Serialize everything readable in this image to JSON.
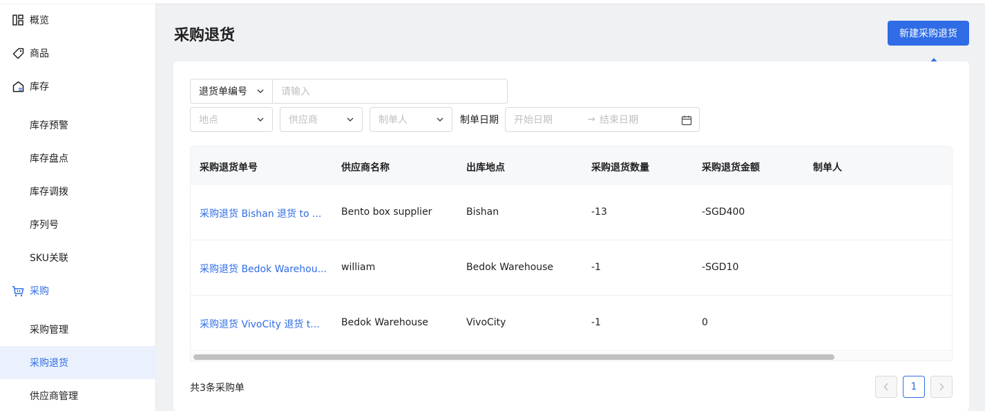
{
  "sidebar": {
    "items": [
      {
        "label": "概览",
        "icon": "overview-icon"
      },
      {
        "label": "商品",
        "icon": "tag-icon"
      },
      {
        "label": "库存",
        "icon": "warehouse-icon"
      },
      {
        "label": "库存预警"
      },
      {
        "label": "库存盘点"
      },
      {
        "label": "库存调拨"
      },
      {
        "label": "序列号"
      },
      {
        "label": "SKU关联"
      },
      {
        "label": "采购",
        "icon": "cart-icon"
      },
      {
        "label": "采购管理"
      },
      {
        "label": "采购退货"
      },
      {
        "label": "供应商管理"
      }
    ]
  },
  "page": {
    "title": "采购退货",
    "new_button": "新建采购退货"
  },
  "filters": {
    "number_type": "退货单编号",
    "number_placeholder": "请输入",
    "location_placeholder": "地点",
    "supplier_placeholder": "供应商",
    "creator_placeholder": "制单人",
    "date_label": "制单日期",
    "start_date_placeholder": "开始日期",
    "date_separator": "→",
    "end_date_placeholder": "结束日期"
  },
  "table": {
    "columns": [
      "采购退货单号",
      "供应商名称",
      "出库地点",
      "采购退货数量",
      "采购退货金额",
      "制单人"
    ],
    "rows": [
      {
        "number": "采购退货 Bishan 退货 to ...",
        "supplier": "Bento box supplier",
        "location": "Bishan",
        "quantity": "-13",
        "amount": "-SGD400",
        "creator": ""
      },
      {
        "number": "采购退货 Bedok Warehou...",
        "supplier": "william",
        "location": "Bedok Warehouse",
        "quantity": "-1",
        "amount": "-SGD10",
        "creator": ""
      },
      {
        "number": "采购退货 VivoCity 退货 t...",
        "supplier": "Bedok Warehouse",
        "location": "VivoCity",
        "quantity": "-1",
        "amount": "0",
        "creator": ""
      }
    ]
  },
  "footer": {
    "total_text": "共3条采购单",
    "current_page": "1"
  },
  "colors": {
    "primary": "#2f6ce5",
    "selected_bg": "#eaf1fd"
  }
}
